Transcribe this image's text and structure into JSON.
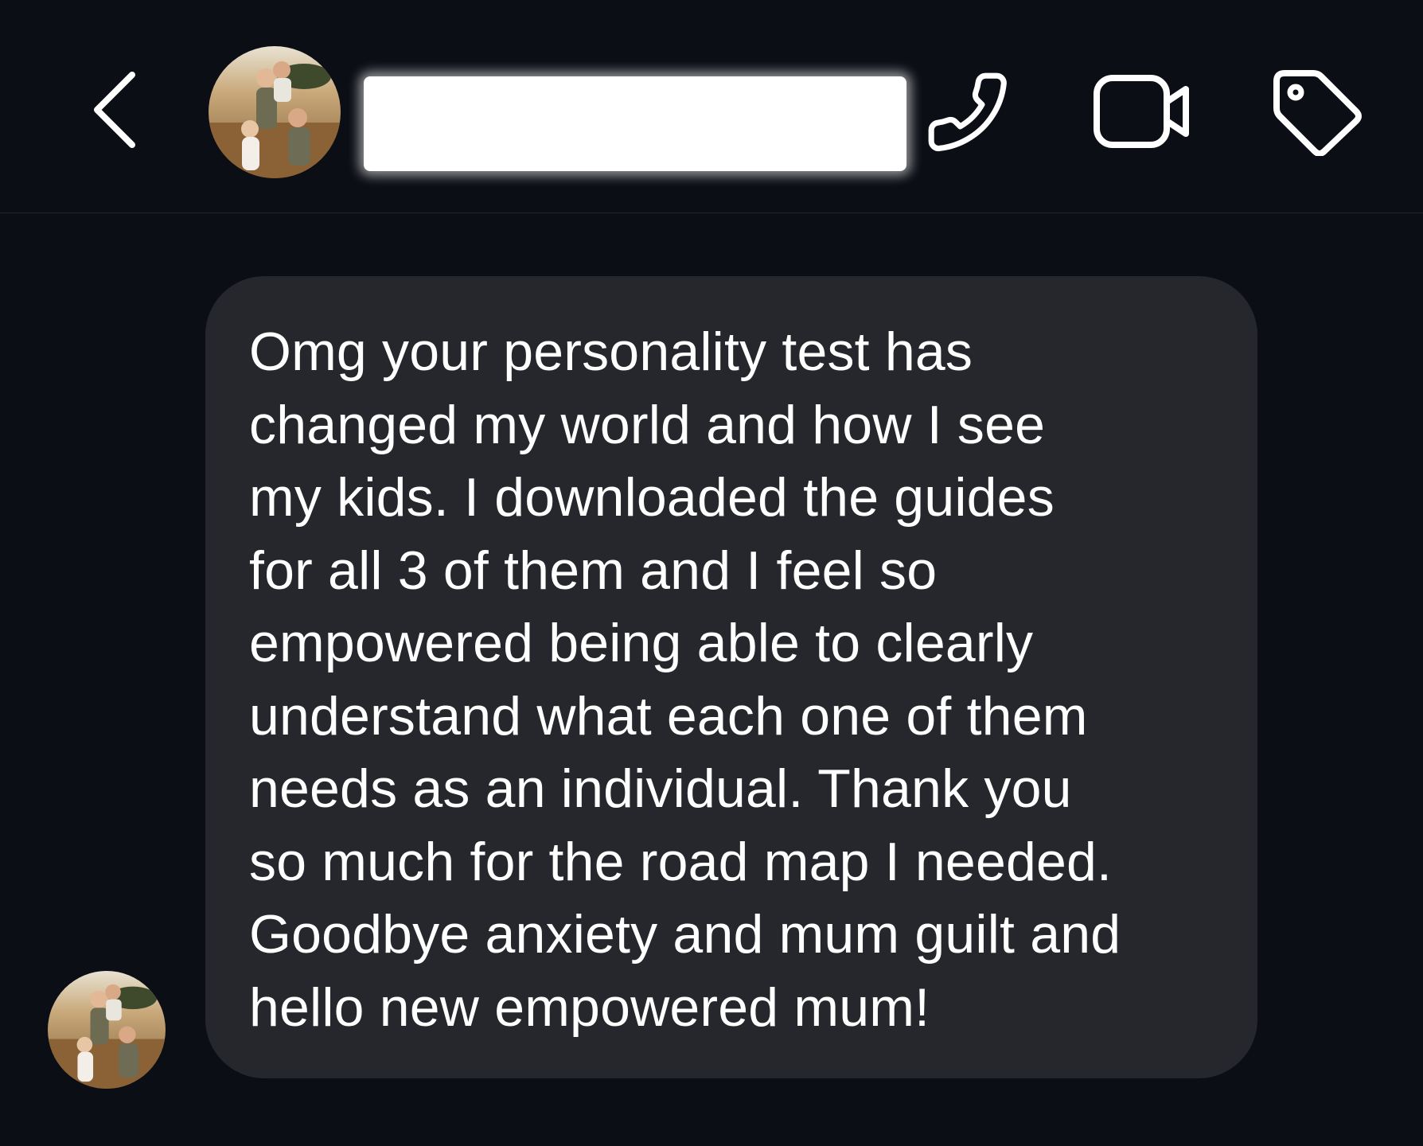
{
  "header": {
    "back_icon": "chevron-left-icon",
    "avatar_icon": "family-photo-avatar",
    "contact_name": "",
    "actions": [
      {
        "name": "call-button",
        "icon": "phone-icon"
      },
      {
        "name": "video-call-button",
        "icon": "video-camera-icon"
      },
      {
        "name": "tag-button",
        "icon": "tag-icon"
      }
    ]
  },
  "conversation": {
    "message": {
      "lines": [
        "Omg your personality test has",
        "changed my world and how I see",
        "my kids. I downloaded the guides",
        "for all 3 of them and I feel so",
        "empowered being able to clearly",
        "understand what each one of them",
        "needs as an individual. Thank you",
        "so much for the road map I needed.",
        "Goodbye anxiety and mum guilt and",
        "hello new empowered mum!"
      ]
    },
    "sender_avatar_icon": "family-photo-avatar"
  },
  "colors": {
    "background": "#0b0e15",
    "bubble": "#25272d",
    "text": "#ffffff",
    "redaction": "#ffffff"
  }
}
